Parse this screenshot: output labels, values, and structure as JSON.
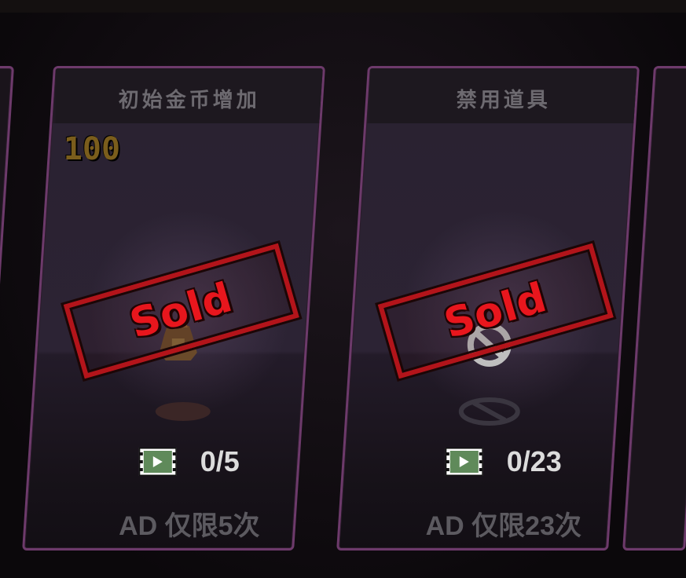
{
  "cards": [
    {
      "title": "初始金币增加",
      "value": "100",
      "item_icon": "coin-pouch-icon",
      "stamp": "Sold",
      "ad_progress": "0/5",
      "ad_limit": "AD 仅限5次"
    },
    {
      "title": "禁用道具",
      "item_icon": "ban-icon",
      "stamp": "Sold",
      "ad_progress": "0/23",
      "ad_limit": "AD 仅限23次"
    }
  ],
  "colors": {
    "card_border": "#6d3a6b",
    "stamp_red": "#e8161d",
    "value_gold": "#7a5d1c",
    "video_icon_green": "#5f8a5a"
  }
}
